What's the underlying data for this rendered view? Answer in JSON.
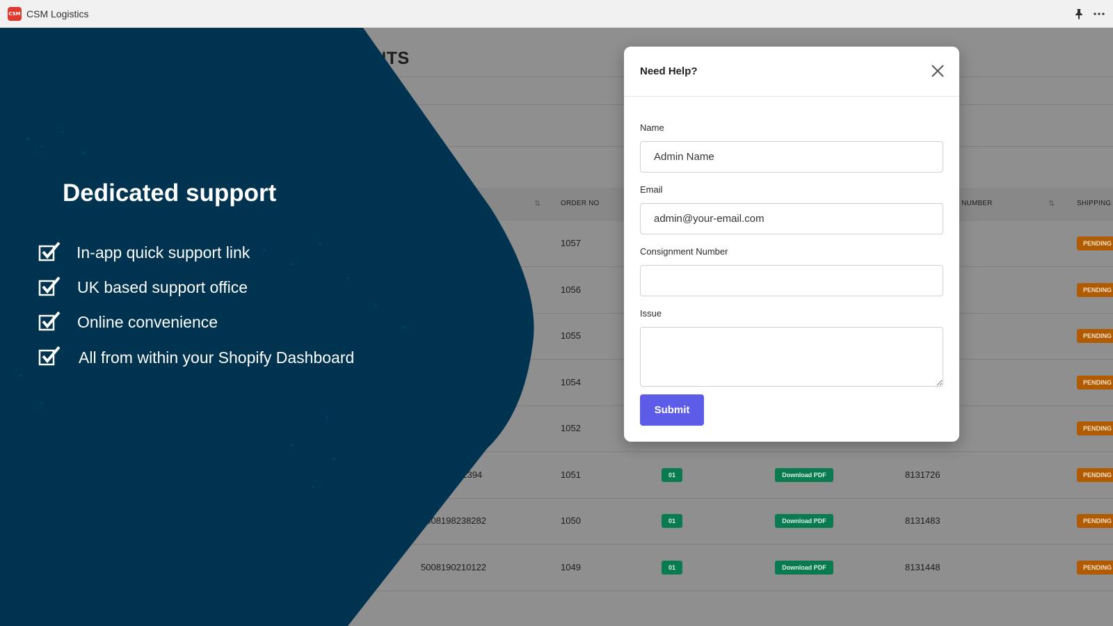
{
  "app": {
    "title": "CSM Logistics",
    "logo_text": "CSM"
  },
  "background": {
    "page_title": "ENTS",
    "columns": {
      "order_no": "ORDER NO",
      "consignment_number_partial": "T NUMBER",
      "shipping": "SHIPPING"
    },
    "rows": [
      {
        "tracking": "",
        "order_no": "1057",
        "service": "",
        "label": "",
        "consignment": "",
        "status": "PENDING"
      },
      {
        "tracking": "",
        "order_no": "1056",
        "service": "",
        "label": "",
        "consignment": "",
        "status": "PENDING"
      },
      {
        "tracking": "",
        "order_no": "1055",
        "service": "",
        "label": "",
        "consignment": "",
        "status": "PENDING"
      },
      {
        "tracking": "",
        "order_no": "1054",
        "service": "",
        "label": "",
        "consignment": "",
        "status": "PENDING"
      },
      {
        "tracking": "",
        "order_no": "1052",
        "service": "",
        "label": "",
        "consignment": "",
        "status": "PENDING"
      },
      {
        "tracking": "32394",
        "order_no": "1051",
        "service": "01",
        "label": "Download PDF",
        "consignment": "8131726",
        "status": "PENDING"
      },
      {
        "tracking": "5008198238282",
        "order_no": "1050",
        "service": "01",
        "label": "Download PDF",
        "consignment": "8131483",
        "status": "PENDING"
      },
      {
        "tracking": "5008190210122",
        "order_no": "1049",
        "service": "01",
        "label": "Download PDF",
        "consignment": "8131448",
        "status": "PENDING"
      }
    ]
  },
  "promo": {
    "title": "Dedicated support",
    "features": [
      "In-app quick support link",
      "UK based support office",
      "Online convenience",
      "All from within your Shopify Dashboard"
    ],
    "colors": {
      "panel": "#003350"
    }
  },
  "modal": {
    "title": "Need Help?",
    "fields": {
      "name": {
        "label": "Name",
        "value": "Admin Name"
      },
      "email": {
        "label": "Email",
        "value": "admin@your-email.com"
      },
      "consignment": {
        "label": "Consignment Number",
        "value": ""
      },
      "issue": {
        "label": "Issue",
        "value": ""
      }
    },
    "submit_label": "Submit",
    "colors": {
      "submit": "#5c5ce8"
    }
  }
}
